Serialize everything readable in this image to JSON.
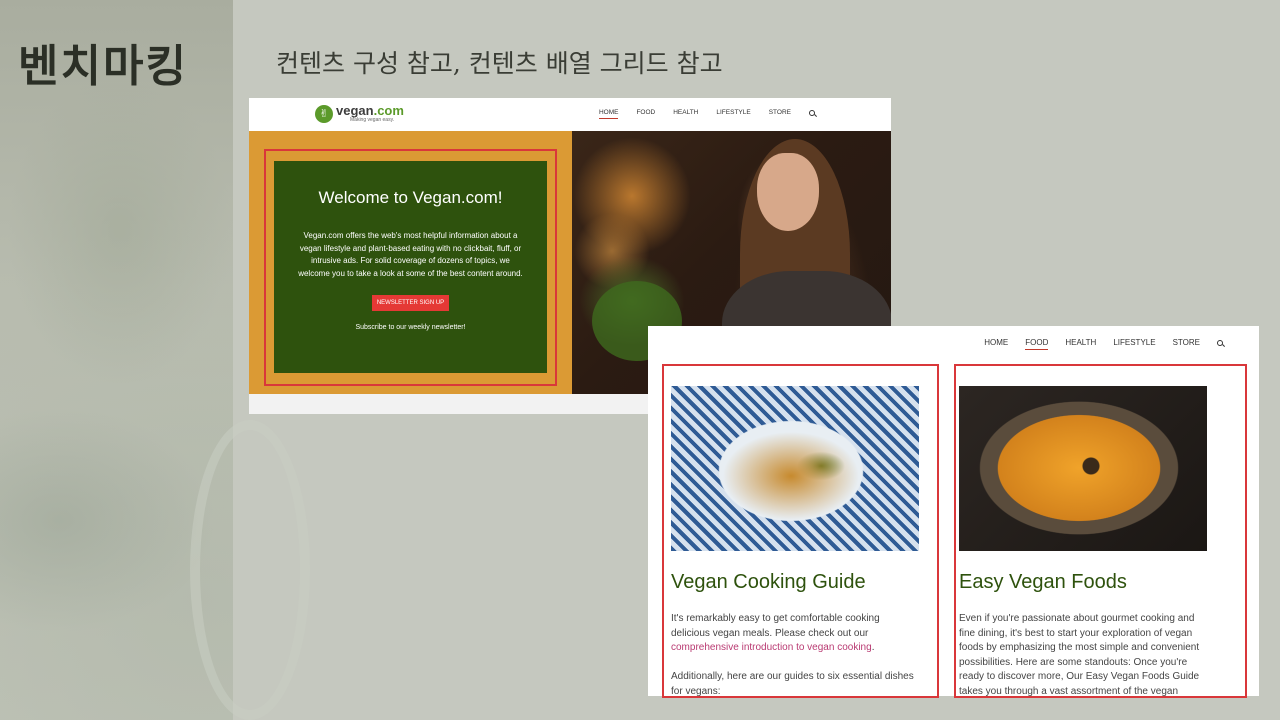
{
  "slide": {
    "title": "벤치마킹",
    "subtitle": "컨텐츠 구성 참고, 컨텐츠 배열 그리드 참고"
  },
  "screenshot1": {
    "logo": {
      "name": "vegan",
      "tld": ".com",
      "tagline": "Making vegan easy."
    },
    "nav": [
      "HOME",
      "FOOD",
      "HEALTH",
      "LIFESTYLE",
      "STORE"
    ],
    "active_nav": "HOME",
    "hero": {
      "title": "Welcome to Vegan.com!",
      "description": "Vegan.com offers the web's most helpful information about a vegan lifestyle and plant-based eating with no clickbait, fluff, or intrusive ads. For solid coverage of dozens of topics, we welcome you to take a look at some of the best content around.",
      "button": "NEWSLETTER SIGN UP",
      "subscribe": "Subscribe to our weekly newsletter!"
    }
  },
  "screenshot2": {
    "nav": [
      "HOME",
      "FOOD",
      "HEALTH",
      "LIFESTYLE",
      "STORE"
    ],
    "active_nav": "FOOD",
    "cards": [
      {
        "title": "Vegan Cooking Guide",
        "text1_before": "It's remarkably easy to get comfortable cooking delicious vegan meals. Please check out our ",
        "text1_link": "comprehensive introduction to vegan cooking",
        "text1_after": ".",
        "text2": "Additionally, here are our guides to six essential dishes for vegans:"
      },
      {
        "title": "Easy Vegan Foods",
        "text1": "Even if you're passionate about gourmet cooking and fine dining, it's best to start your exploration of vegan foods by emphasizing the most simple and convenient possibilities. Here are some standouts: Once you're ready to discover more, Our Easy Vegan Foods Guide takes you through a vast assortment of the vegan world's most delicious ready-to-eat"
      }
    ]
  },
  "colors": {
    "highlight": "#d9373a",
    "brand_green": "#2e520d",
    "hero_orange": "#db9a34",
    "button_red": "#e53935"
  }
}
